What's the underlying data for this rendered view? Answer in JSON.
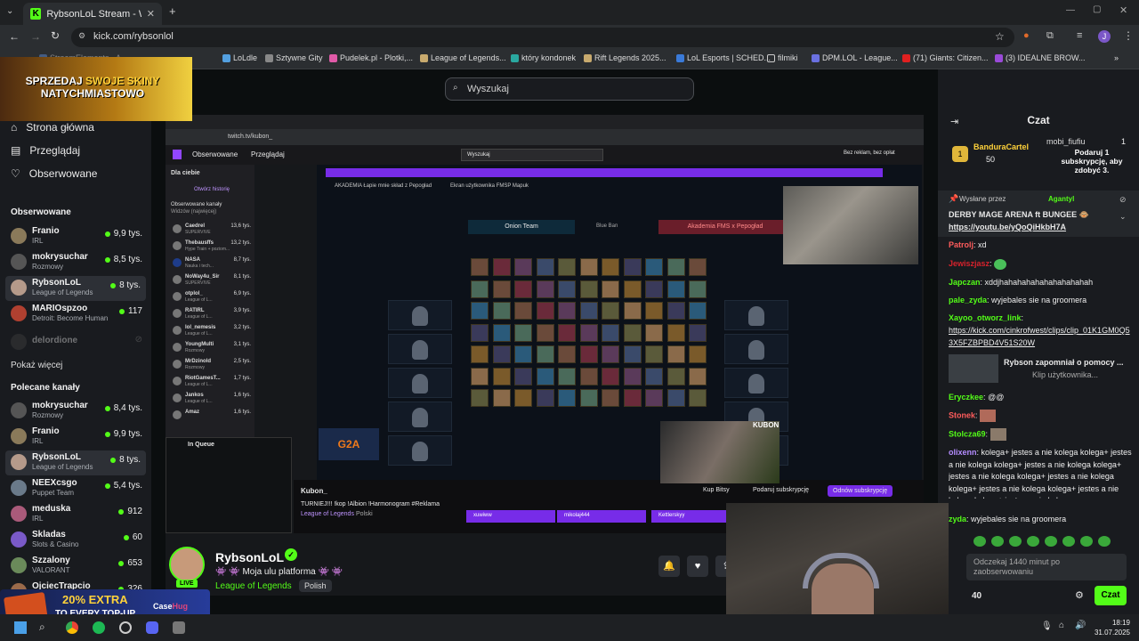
{
  "browser": {
    "tab_title": "RybsonLoL Stream - Watch Live",
    "url": "kick.com/rybsonlol",
    "bookmarks": [
      "StreamElements - A...",
      "LoLdle",
      "Sztywne Gity",
      "Pudelek.pl - Plotki,...",
      "League of Legends...",
      "który kondonek",
      "Rift Legends 2025...",
      "LoL Esports | SCHED...",
      "filmiki",
      "DPM.LOL - League...",
      "(71) Giants: Citizen...",
      "(3) IDEALNE BROW..."
    ],
    "profile_initial": "J"
  },
  "promo_top": {
    "line1_a": "SPRZEDAJ ",
    "line1_b": "SWOJE SKINY",
    "line2": "NATYCHMIASTOWO"
  },
  "search": {
    "placeholder": "Wyszukaj"
  },
  "sidebar": {
    "nav": [
      "Strona główna",
      "Przeglądaj",
      "Obserwowane"
    ],
    "followed_title": "Obserwowane",
    "followed": [
      {
        "name": "Franio",
        "game": "IRL",
        "viewers": "9,9 tys."
      },
      {
        "name": "mokrysuchar",
        "game": "Rozmowy",
        "viewers": "8,5 tys."
      },
      {
        "name": "RybsonLoL",
        "game": "League of Legends",
        "viewers": "8 tys."
      },
      {
        "name": "MARIOspzoo",
        "game": "Detroit: Become Human",
        "viewers": "117"
      },
      {
        "name": "delordione",
        "game": "",
        "viewers": ""
      }
    ],
    "show_more": "Pokaż więcej",
    "recommended_title": "Polecane kanały",
    "recommended": [
      {
        "name": "mokrysuchar",
        "game": "Rozmowy",
        "viewers": "8,4 tys."
      },
      {
        "name": "Franio",
        "game": "IRL",
        "viewers": "9,9 tys."
      },
      {
        "name": "RybsonLoL",
        "game": "League of Legends",
        "viewers": "8 tys."
      },
      {
        "name": "NEEXcsgo",
        "game": "Puppet Team",
        "viewers": "5,4 tys."
      },
      {
        "name": "meduska",
        "game": "IRL",
        "viewers": "912"
      },
      {
        "name": "Skladas",
        "game": "Slots & Casino",
        "viewers": "60"
      },
      {
        "name": "Szzalony",
        "game": "VALORANT",
        "viewers": "653"
      },
      {
        "name": "OjciecTrapcio",
        "game": "",
        "viewers": "326"
      }
    ]
  },
  "video": {
    "tw_url": "twitch.tv/kubon_",
    "tw_nav": [
      "Obserwowane",
      "Przeglądaj"
    ],
    "tw_search": "Wyszukaj",
    "tw_ads": "Bez reklam, bez opłat",
    "tw_banner": "AKADEMIA Łapie mnie skład z Pepogład",
    "tw_banner2": "Ekran użytkownika FMSP Mapuk",
    "tw_side_title": "Dla ciebie",
    "tw_side_history": "Otwórz historię",
    "tw_side_followed": "Obserwowane kanały",
    "tw_side_sort": "Widzów (najwięcej)",
    "tw_channels": [
      {
        "n": "Caedrel",
        "g": "SUPERVIVE",
        "v": "13,6 tys."
      },
      {
        "n": "Thebausffs",
        "g": "Hype Train + poziom...",
        "v": "13,2 tys."
      },
      {
        "n": "NASA",
        "g": "Nauka i tech...",
        "v": "8,7 tys."
      },
      {
        "n": "NoWay4u_Sir",
        "g": "SUPERVIVE",
        "v": "8,1 tys."
      },
      {
        "n": "otplol_",
        "g": "League of L...",
        "v": "6,9 tys."
      },
      {
        "n": "RATIRL",
        "g": "League of L...",
        "v": "3,9 tys."
      },
      {
        "n": "lol_nemesis",
        "g": "League of L...",
        "v": "3,2 tys."
      },
      {
        "n": "YoungMulti",
        "g": "Rozmowy",
        "v": "3,1 tys."
      },
      {
        "n": "MrDzinold",
        "g": "Rozmowy",
        "v": "2,5 tys."
      },
      {
        "n": "RiotGamesT...",
        "g": "League of L...",
        "v": "1,7 tys."
      },
      {
        "n": "Jankos",
        "g": "League of L...",
        "v": "1,6 tys."
      },
      {
        "n": "Amaz",
        "g": "",
        "v": "1,6 tys."
      }
    ],
    "tw_inqueue": "In Queue",
    "team_left": "Onion Team",
    "team_mid": "Blue Ban",
    "team_right": "Akademia FMS x Pepogład",
    "tw_streamer": "Kubon_",
    "tw_title": "TURNIEJ!!! !kop !Albion !Harmonogram #Reklama",
    "tw_game": "League of Legends",
    "tw_lang": "Polski",
    "tw_buy": "Kup Bitsy",
    "tw_sub": "Podaruj subskrypcję",
    "tw_renew": "Odnów subskrypcję",
    "tw_chips": [
      "xuwiww",
      "mikolaj444",
      "Kettlerskyy"
    ],
    "g2a": "G2A",
    "overlay_name": "KUBON"
  },
  "stream": {
    "live": "LIVE",
    "name": "RybsonLoL",
    "title": "👾 👾 Moja ulu platforma 👾 👾",
    "category": "League of Legends",
    "language": "Polish"
  },
  "promo_bottom": {
    "line1": "20% EXTRA",
    "line2": "TO EVERY TOP-UP",
    "brand_a": "Case",
    "brand_b": "Hug"
  },
  "chat": {
    "title": "Czat",
    "top_gifter": {
      "name": "BanduraCartel",
      "amount": "50"
    },
    "top_gifter2": {
      "name": "mobi_fiufiu",
      "amount": "1"
    },
    "gift_msg": "Podaruj 1 subskrypcję, aby zdobyć 3.",
    "pinned_by": "Wysłane przez",
    "pinned_user": "Agantyl",
    "pinned_text": "DERBY MAGE ARENA ft BUNGEE 🐵",
    "pinned_link": "https://youtu.be/yQoQiHkbH7A",
    "messages": [
      {
        "user": "Patrolj",
        "color": "#ff5c5c",
        "text": "xd"
      },
      {
        "user": "Jewiszjasz",
        "color": "#d8222c",
        "text": ""
      },
      {
        "user": "Japczan",
        "color": "#53fc18",
        "text": "xddjhahahahahahahahahahah"
      },
      {
        "user": "pale_zyda",
        "color": "#53fc18",
        "text": "wyjebales sie na groomera"
      },
      {
        "user": "Xayoo_otworz_link",
        "color": "#53fc18",
        "text": ""
      },
      {
        "user": "",
        "color": "#ffffff",
        "text": "https://kick.com/cinkrofwest/clips/clip_01K1GM0Q53X5FZBPBD4V51S20W"
      },
      {
        "user": "Eryczkee",
        "color": "#53fc18",
        "text": "@@"
      },
      {
        "user": "Stonek",
        "color": "#ff5c5c",
        "text": ""
      },
      {
        "user": "Stolcza69",
        "color": "#53fc18",
        "text": ""
      },
      {
        "user": "olixenn",
        "color": "#b48cff",
        "text": "kolega+ jestes a nie kolega kolega+ jestes a nie kolega kolega+ jestes a nie kolega kolega+ jestes a nie kolega kolega+ jestes a nie kolega kolega+ jestes a nie kolega kolega+ jestes a nie kolega kolega+ jestes a nie kolega"
      },
      {
        "user": "zyda",
        "color": "#53fc18",
        "text": "wyjebales sie na groomera"
      }
    ],
    "clip_title": "Rybson zapomniał o pomocy ...",
    "clip_sub": "Klip użytkownika...",
    "input_placeholder": "Odczekaj 1440 minut po zaobserwowaniu",
    "counter": "40",
    "send": "Czat"
  },
  "clock": {
    "time": "18:19",
    "date": "31.07.2025"
  }
}
